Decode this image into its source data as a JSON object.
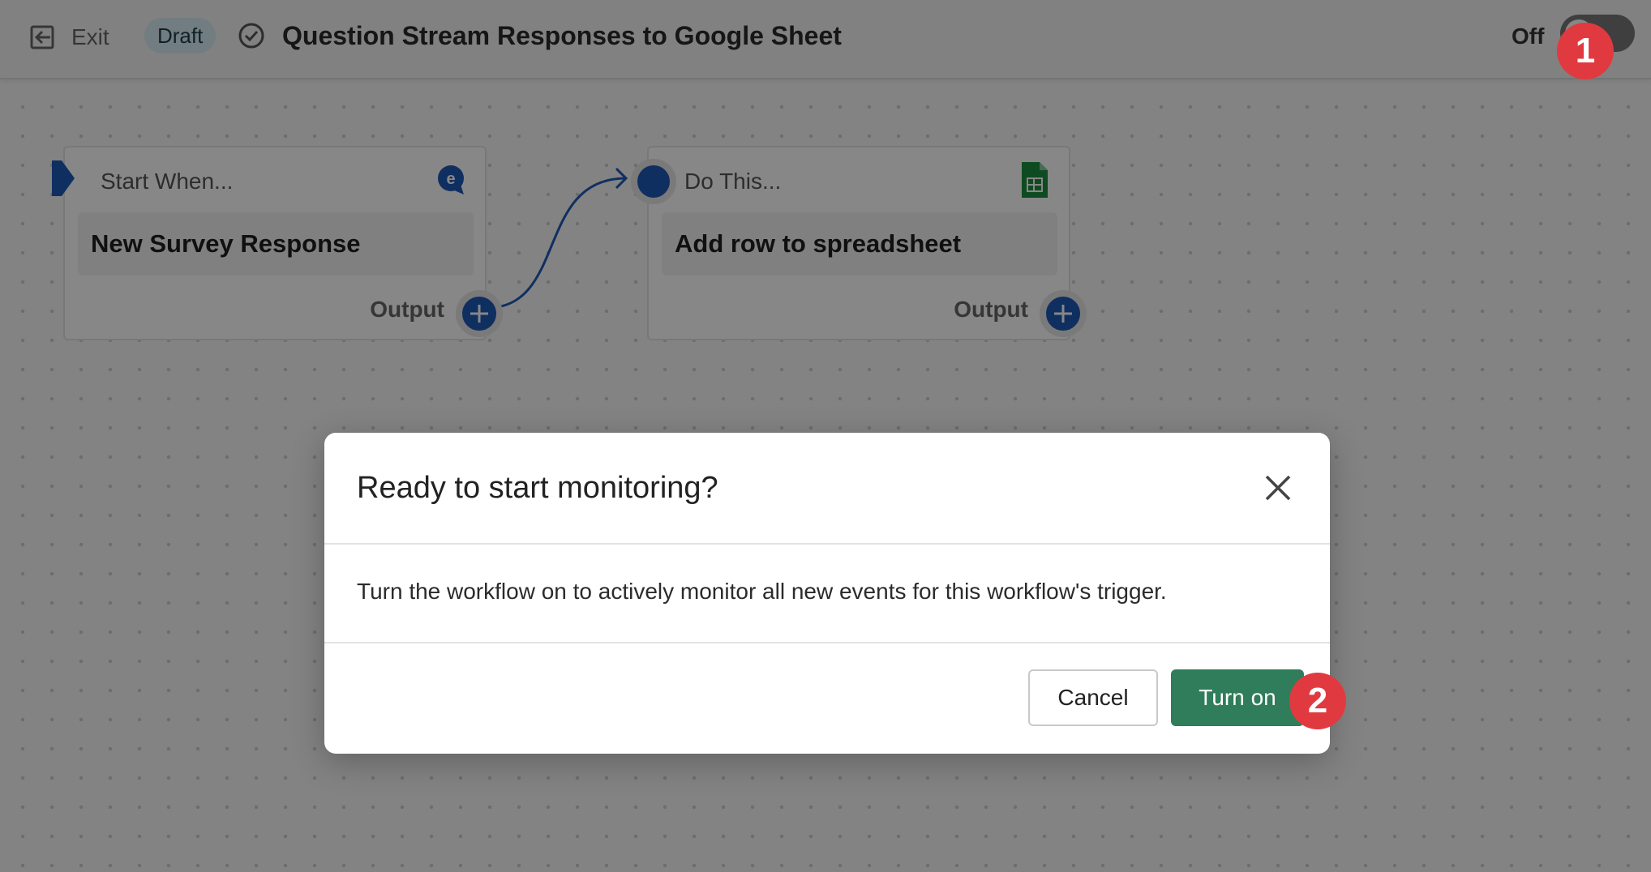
{
  "topbar": {
    "exit_label": "Exit",
    "status_badge": "Draft",
    "workflow_title": "Question Stream Responses to Google Sheet",
    "toggle_label": "Off"
  },
  "canvas": {
    "nodes": [
      {
        "header": "Start When...",
        "action": "New Survey Response",
        "output_label": "Output",
        "icon": "question-stream-icon"
      },
      {
        "header": "Do This...",
        "action": "Add row to spreadsheet",
        "output_label": "Output",
        "icon": "google-sheets-icon"
      }
    ]
  },
  "modal": {
    "title": "Ready to start monitoring?",
    "body": "Turn the workflow on to actively monitor all new events for this workflow's trigger.",
    "cancel_label": "Cancel",
    "confirm_label": "Turn on"
  },
  "annotations": {
    "step1": "1",
    "step2": "2"
  },
  "colors": {
    "accent_blue": "#1f59b8",
    "confirm_green": "#2f7d5a",
    "badge_bg": "#d5ecf1",
    "step_marker": "#e03a40"
  }
}
